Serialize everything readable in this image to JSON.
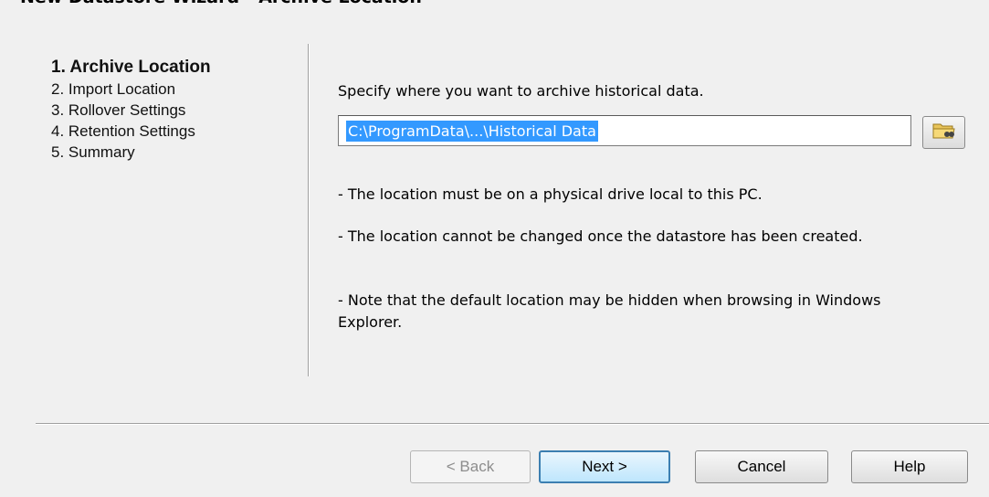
{
  "window": {
    "title": "New Datastore Wizard - Archive Location"
  },
  "steps": [
    {
      "label": "1. Archive Location"
    },
    {
      "label": "2. Import Location"
    },
    {
      "label": "3. Rollover Settings"
    },
    {
      "label": "4. Retention Settings"
    },
    {
      "label": "5. Summary"
    }
  ],
  "content": {
    "instruction": "Specify where you want to archive historical data.",
    "path_value": "C:\\ProgramData\\...\\Historical Data",
    "browse_icon": "folder-browse-icon",
    "notes": [
      "- The location must be on a physical drive local to this PC.",
      "- The location cannot be changed once the datastore has been created.",
      "- Note that the default location may be hidden when browsing in Windows Explorer."
    ]
  },
  "buttons": {
    "back": "< Back",
    "next": "Next >",
    "cancel": "Cancel",
    "help": "Help"
  }
}
